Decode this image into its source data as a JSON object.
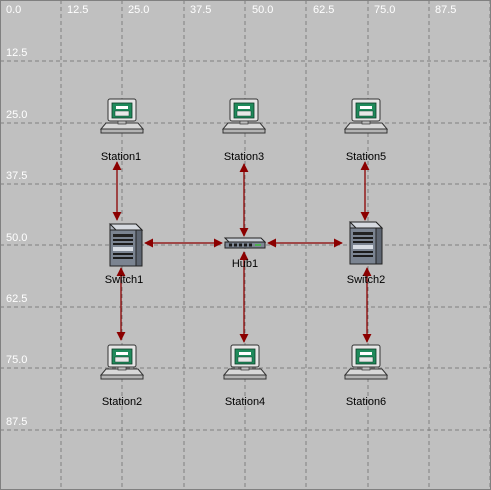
{
  "axis": {
    "x_ticks": [
      "0.0",
      "12.5",
      "25.0",
      "37.5",
      "50.0",
      "62.5",
      "75.0",
      "87.5"
    ],
    "y_ticks": [
      "12.5",
      "25.0",
      "37.5",
      "50.0",
      "62.5",
      "75.0",
      "87.5"
    ]
  },
  "nodes": {
    "station1": "Station1",
    "station2": "Station2",
    "station3": "Station3",
    "station4": "Station4",
    "station5": "Station5",
    "station6": "Station6",
    "switch1": "Switch1",
    "switch2": "Switch2",
    "hub1": "Hub1"
  },
  "links": [
    [
      "station1",
      "switch1"
    ],
    [
      "station2",
      "switch1"
    ],
    [
      "switch1",
      "hub1"
    ],
    [
      "station3",
      "hub1"
    ],
    [
      "station4",
      "hub1"
    ],
    [
      "switch2",
      "hub1"
    ],
    [
      "station5",
      "switch2"
    ],
    [
      "station6",
      "switch2"
    ]
  ],
  "colors": {
    "background": "#c0c0c0",
    "grid": "#808080",
    "link": "#8b0000",
    "screen": "#2e8b57"
  },
  "icons": {
    "station": "computer-workstation-icon",
    "switch": "network-switch-icon",
    "hub": "network-hub-icon"
  }
}
